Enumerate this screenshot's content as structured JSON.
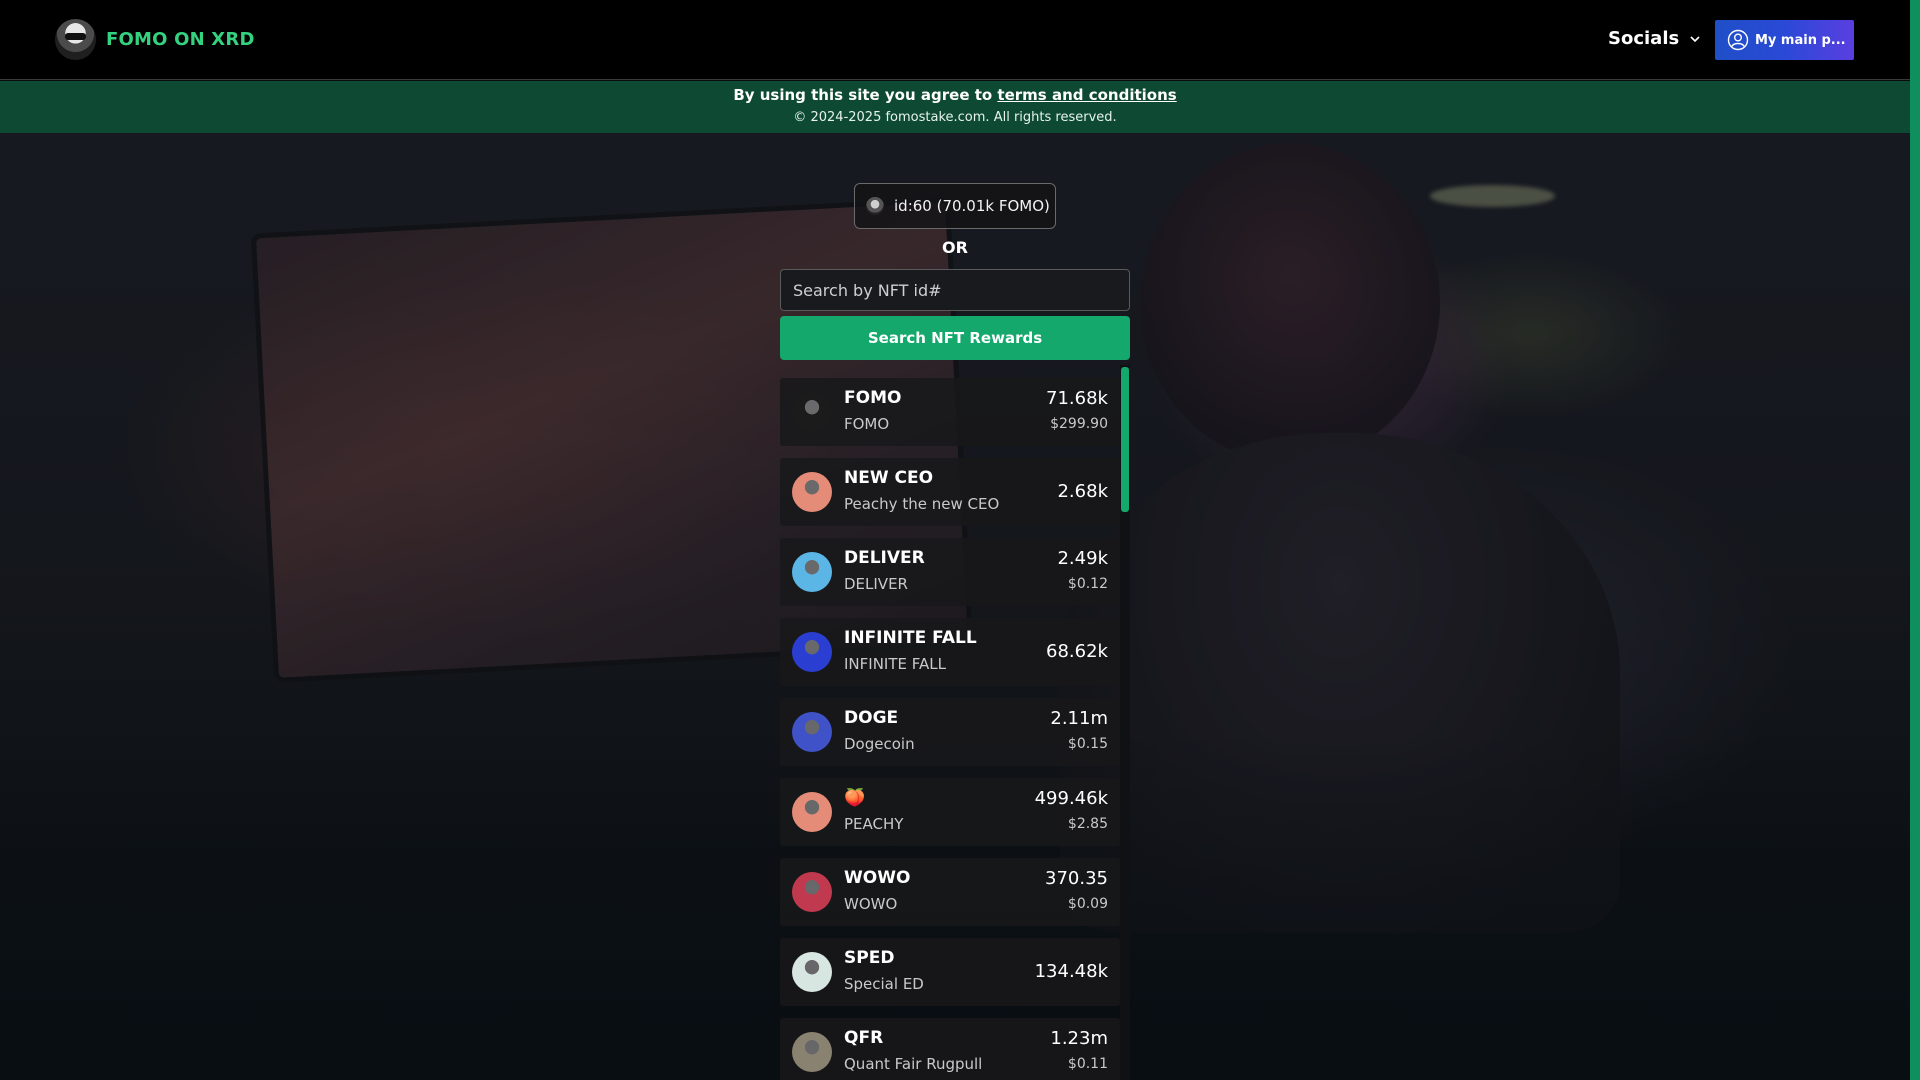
{
  "header": {
    "brand": "FOMO ON XRD",
    "socials_label": "Socials",
    "wallet_label": "My main p..."
  },
  "terms": {
    "prefix": "By using this site you agree to ",
    "link": "terms and conditions",
    "copyright": "© 2024-2025 fomostake.com. All rights reserved."
  },
  "search": {
    "selected_id": "id:60  (70.01k FOMO)",
    "or_label": "OR",
    "placeholder": "Search by NFT id#",
    "button_label": "Search NFT Rewards"
  },
  "tokens": [
    {
      "symbol": "FOMO",
      "name": "FOMO",
      "amount": "71.68k",
      "usd": "$299.90",
      "icon": "frog-icon",
      "color": "#1b1b1b"
    },
    {
      "symbol": "NEW CEO",
      "name": "Peachy the new CEO",
      "amount": "2.68k",
      "usd": "",
      "icon": "peach-face-icon",
      "color": "#e58c78"
    },
    {
      "symbol": "DELIVER",
      "name": "DELIVER",
      "amount": "2.49k",
      "usd": "$0.12",
      "icon": "box-icon",
      "color": "#5bb6e6"
    },
    {
      "symbol": "INFINITE FALL",
      "name": "INFINITE FALL",
      "amount": "68.62k",
      "usd": "",
      "icon": "chart-down-icon",
      "color": "#2a3fd2"
    },
    {
      "symbol": "DOGE",
      "name": "Dogecoin",
      "amount": "2.11m",
      "usd": "$0.15",
      "icon": "doge-icon",
      "color": "#3f52c7"
    },
    {
      "symbol": "🍑",
      "name": "PEACHY",
      "amount": "499.46k",
      "usd": "$2.85",
      "icon": "peach-face-icon",
      "color": "#e58c78"
    },
    {
      "symbol": "WOWO",
      "name": "WOWO",
      "amount": "370.35",
      "usd": "$0.09",
      "icon": "anime-girl-icon",
      "color": "#c0394f"
    },
    {
      "symbol": "SPED",
      "name": "Special ED",
      "amount": "134.48k",
      "usd": "",
      "icon": "cartoon-face-icon",
      "color": "#d7e6e0"
    },
    {
      "symbol": "QFR",
      "name": "Quant Fair Rugpull",
      "amount": "1.23m",
      "usd": "$0.11",
      "icon": "portrait-icon",
      "color": "#8a8270"
    }
  ]
}
